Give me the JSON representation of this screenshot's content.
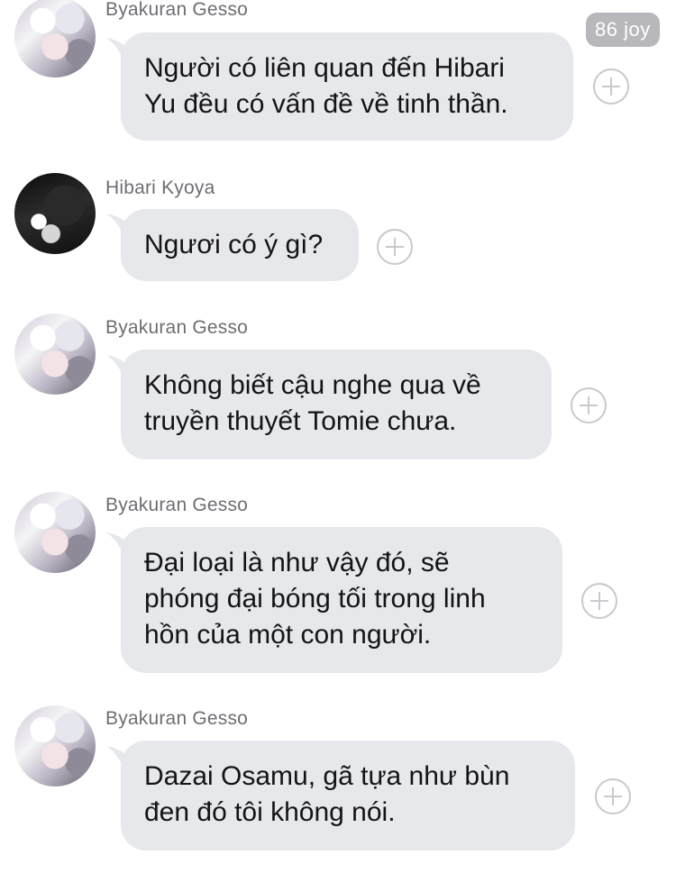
{
  "joy_badge": "86 joy",
  "messages": [
    {
      "sender": "Byakuran Gesso",
      "avatar": "byakuran-avatar",
      "text": "Người có liên quan đến Hibari\nYu đều có vấn đề về tinh thần."
    },
    {
      "sender": "Hibari Kyoya",
      "avatar": "hibari-avatar",
      "text": "Ngươi có ý gì?"
    },
    {
      "sender": "Byakuran Gesso",
      "avatar": "byakuran-avatar",
      "text": "Không biết cậu nghe qua về\ntruyền thuyết Tomie chưa."
    },
    {
      "sender": "Byakuran Gesso",
      "avatar": "byakuran-avatar",
      "text": "Đại loại là như vậy đó, sẽ\nphóng đại bóng tối trong linh\nhồn của một con người."
    },
    {
      "sender": "Byakuran Gesso",
      "avatar": "byakuran-avatar",
      "text": "Dazai Osamu, gã tựa như bùn\nđen đó tôi không nói."
    }
  ],
  "colors": {
    "bubble": "#e6e8ec",
    "sender_text": "#6e6e73",
    "badge": "#b7b7bc"
  }
}
